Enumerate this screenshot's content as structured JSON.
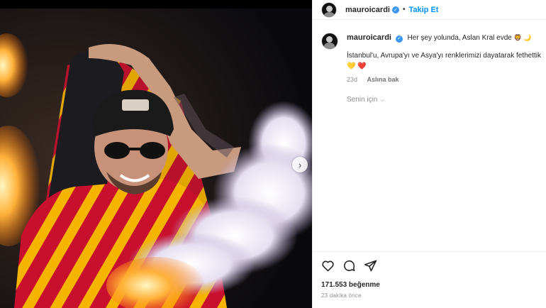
{
  "post": {
    "username": "mauroicardi",
    "follow_label": "Takip Et",
    "separator": "•",
    "verified_mark": "✓"
  },
  "caption": {
    "username": "mauroicardi",
    "text": "Her şey yolunda, Aslan Kral evde",
    "emojis": "🦁 🌙",
    "line2": "İstanbul'u, Avrupa'yı ve Asya'yı renklerimizi dayatarak fethettik",
    "hearts": [
      "💛",
      "❤️"
    ],
    "age": "23d",
    "see_original": "Aslına bak"
  },
  "for_you": {
    "label": "Senin için",
    "chevron": "⌵"
  },
  "actions": {
    "likes": "171.553 beğenme",
    "time": "23 dakika önce",
    "icons": [
      "heart-icon",
      "comment-icon",
      "share-icon"
    ]
  },
  "media": {
    "next_glyph": "›"
  },
  "colors": {
    "accent": "#0095f6",
    "verified": "#3897f0",
    "text": "#262626",
    "muted": "#8e8e8e"
  }
}
